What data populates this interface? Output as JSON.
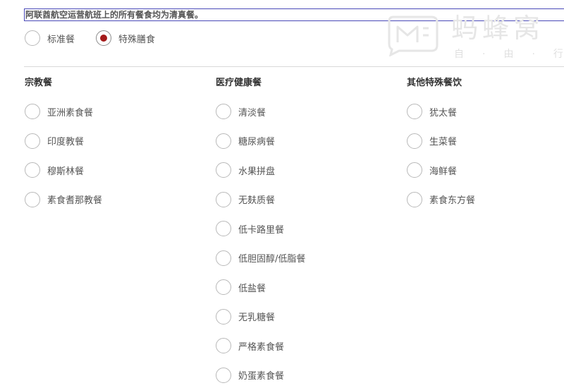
{
  "notice": {
    "text": "阿联酋航空运营航班上的所有餐食均为清真餐。"
  },
  "meal_type": {
    "options": [
      {
        "label": "标准餐",
        "selected": false
      },
      {
        "label": "特殊膳食",
        "selected": true
      }
    ]
  },
  "columns": [
    {
      "title": "宗教餐",
      "options": [
        "亚洲素食餐",
        "印度教餐",
        "穆斯林餐",
        "素食耆那教餐"
      ]
    },
    {
      "title": "医疗健康餐",
      "options": [
        "清淡餐",
        "糖尿病餐",
        "水果拼盘",
        "无麸质餐",
        "低卡路里餐",
        "低胆固醇/低脂餐",
        "低盐餐",
        "无乳糖餐",
        "严格素食餐",
        "奶蛋素食餐"
      ]
    },
    {
      "title": "其他特殊餐饮",
      "options": [
        "犹太餐",
        "生菜餐",
        "海鲜餐",
        "素食东方餐"
      ]
    }
  ],
  "watermark": {
    "brand": "蚂蜂窝",
    "slogan": "自·由·行"
  },
  "colors": {
    "accent_selected": "#a41a1a",
    "notice_border": "#4a4ab8",
    "radio_border": "#b8b8b8",
    "divider": "#d9d9d9"
  }
}
